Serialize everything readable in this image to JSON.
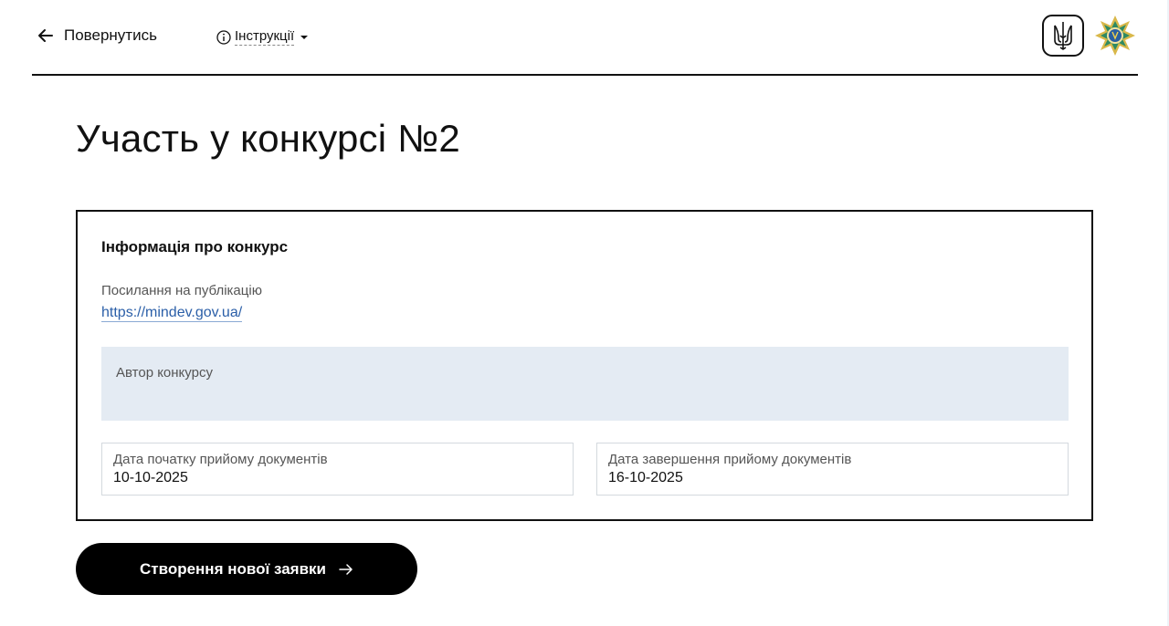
{
  "header": {
    "back_label": "Повернутись",
    "instructions_label": "Інструкції"
  },
  "page_title": "Участь у конкурсі №2",
  "card": {
    "title": "Інформація про конкурс",
    "publication_label": "Посилання на публікацію",
    "publication_link": "https://mindev.gov.ua/",
    "author_label": "Автор конкурсу",
    "start_date_label": "Дата початку прийому документів",
    "start_date_value": "10-10-2025",
    "end_date_label": "Дата завершення прийому документів",
    "end_date_value": "16-10-2025"
  },
  "create_button_label": "Створення нової заявки",
  "icons": {
    "back": "arrow-left-icon",
    "info": "info-icon",
    "caret": "caret-down-icon",
    "trident": "trident-icon",
    "emblem": "emblem-icon",
    "button_arrow": "arrow-right-icon"
  },
  "colors": {
    "link": "#2b5fa8",
    "author_bg": "#e4ebf3",
    "button_bg": "#000000"
  }
}
